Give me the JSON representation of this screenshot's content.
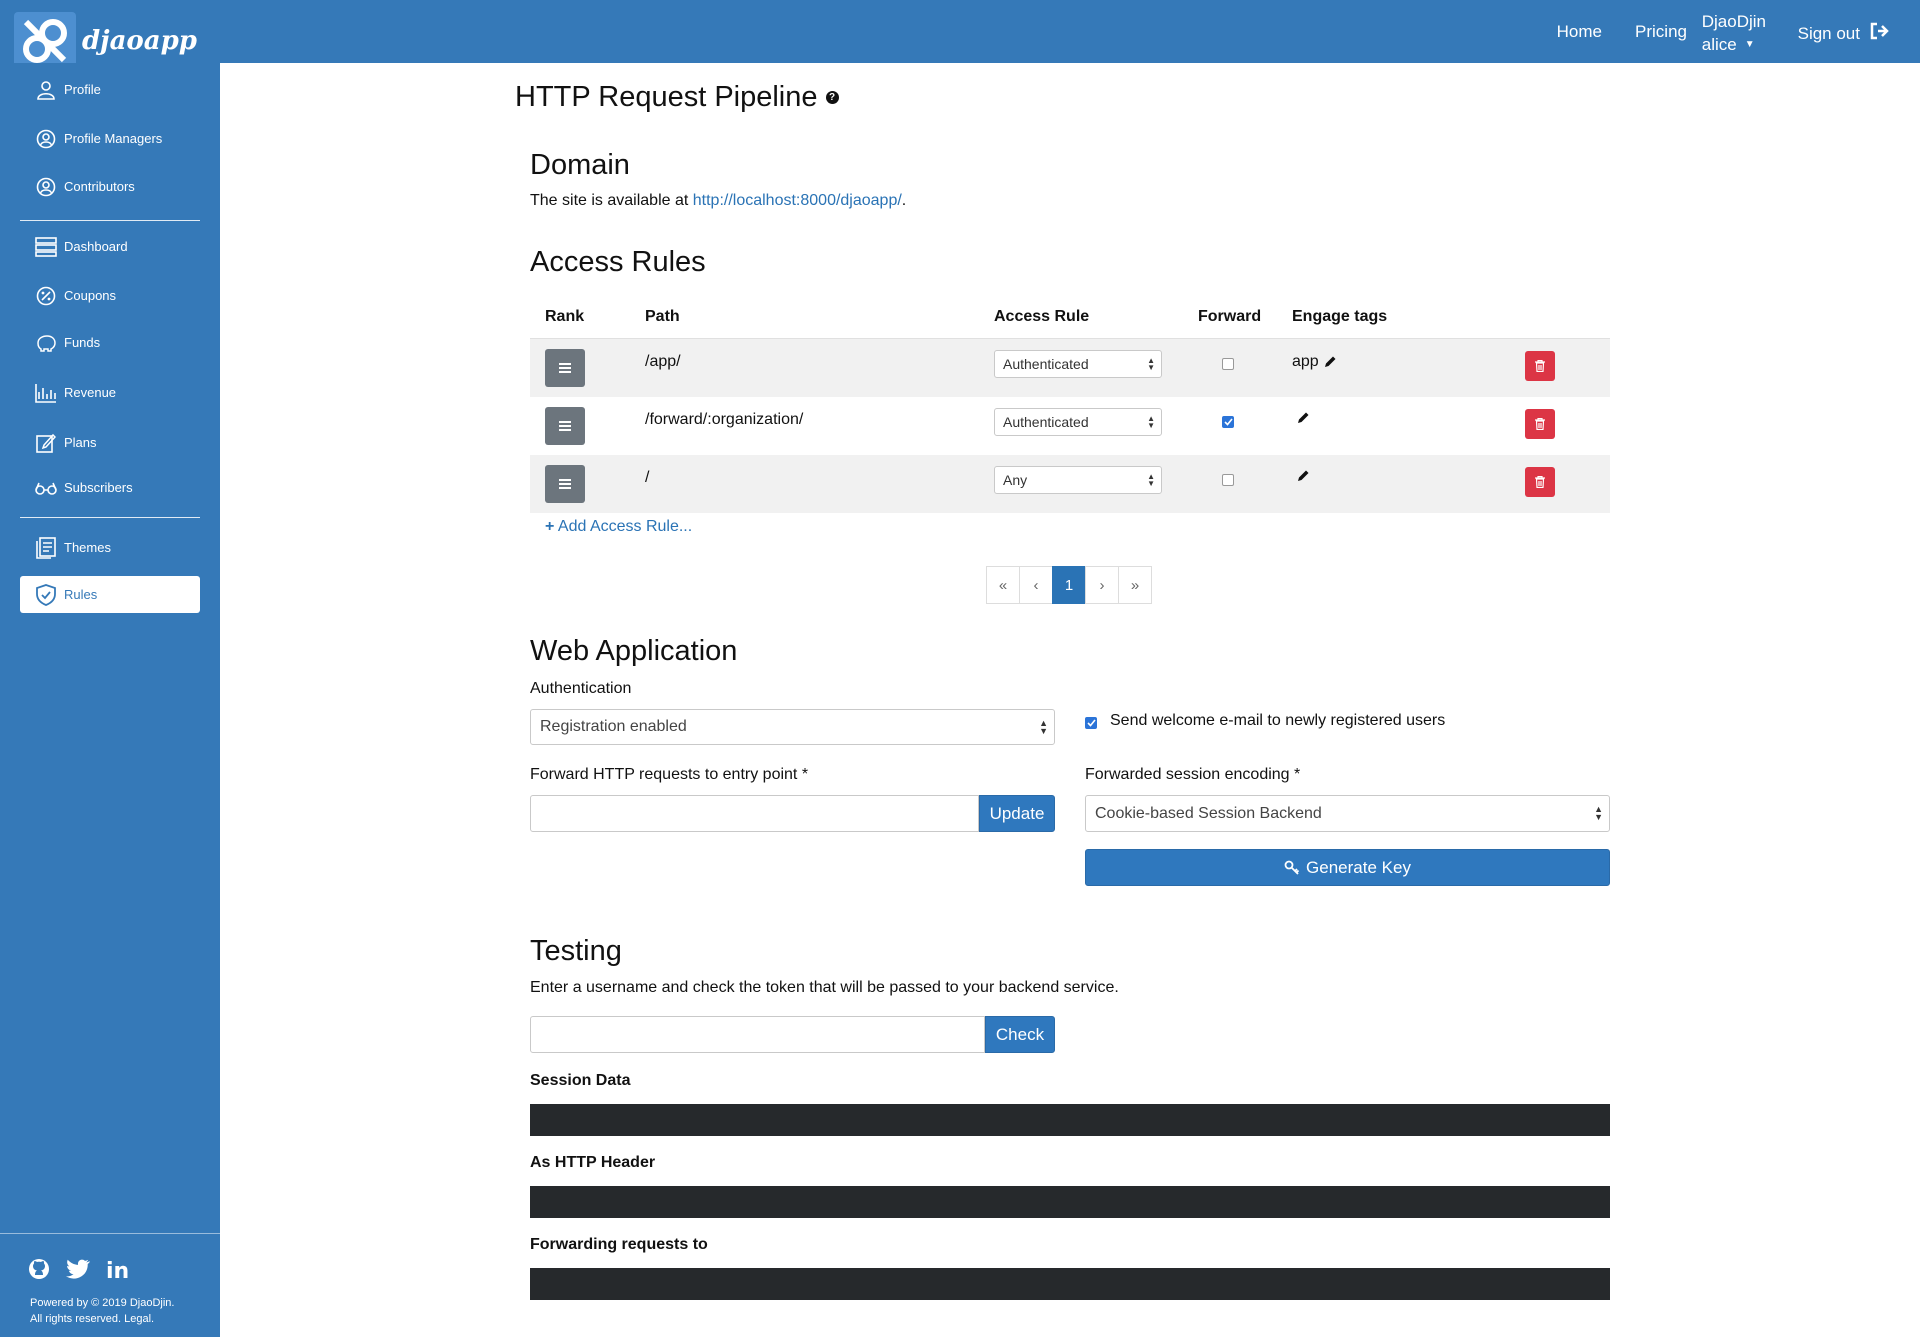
{
  "header": {
    "brand": "djaoapp",
    "nav": {
      "home": "Home",
      "pricing": "Pricing",
      "org_name": "DjaoDjin",
      "user_name": "alice",
      "signout": "Sign out"
    }
  },
  "sidebar": {
    "items": [
      {
        "label": "Profile",
        "icon": "user-icon"
      },
      {
        "label": "Profile Managers",
        "icon": "user-circle-icon"
      },
      {
        "label": "Contributors",
        "icon": "user-circle-icon"
      },
      {
        "label": "Dashboard",
        "icon": "dashboard-icon"
      },
      {
        "label": "Coupons",
        "icon": "percent-icon"
      },
      {
        "label": "Funds",
        "icon": "piggy-bank-icon"
      },
      {
        "label": "Revenue",
        "icon": "chart-icon"
      },
      {
        "label": "Plans",
        "icon": "edit-icon"
      },
      {
        "label": "Subscribers",
        "icon": "glasses-icon"
      },
      {
        "label": "Themes",
        "icon": "document-icon"
      },
      {
        "label": "Rules",
        "icon": "shield-icon"
      }
    ],
    "active": "Rules",
    "footer": {
      "line1": "Powered by © 2019 DjaoDjin.",
      "line2": "All rights reserved. Legal."
    }
  },
  "page": {
    "title": "HTTP Request Pipeline",
    "domain": {
      "heading": "Domain",
      "text_before": "The site is available at ",
      "link": "http://localhost:8000/djaoapp/",
      "text_after": "."
    },
    "access_rules": {
      "heading": "Access Rules",
      "columns": [
        "Rank",
        "Path",
        "Access Rule",
        "Forward",
        "Engage tags"
      ],
      "rows": [
        {
          "path": "/app/",
          "rule": "Authenticated",
          "forward": false,
          "tags": "app"
        },
        {
          "path": "/forward/:organization/",
          "rule": "Authenticated",
          "forward": true,
          "tags": ""
        },
        {
          "path": "/",
          "rule": "Any",
          "forward": false,
          "tags": ""
        }
      ],
      "add_label": "Add Access Rule...",
      "pagination": [
        "«",
        "‹",
        "1",
        "›",
        "»"
      ],
      "current_page": "1"
    },
    "web_app": {
      "heading": "Web Application",
      "auth_label": "Authentication",
      "auth_value": "Registration enabled",
      "welcome_label": "Send welcome e-mail to newly registered users",
      "welcome_checked": true,
      "entry_label": "Forward HTTP requests to entry point *",
      "entry_value": "",
      "update_label": "Update",
      "encoding_label": "Forwarded session encoding *",
      "encoding_value": "Cookie-based Session Backend",
      "generate_label": "Generate Key"
    },
    "testing": {
      "heading": "Testing",
      "description": "Enter a username and check the token that will be passed to your backend service.",
      "username_value": "",
      "check_label": "Check",
      "session_data_label": "Session Data",
      "http_header_label": "As HTTP Header",
      "forwarding_label": "Forwarding requests to"
    }
  },
  "colors": {
    "brand": "#3579b8",
    "danger": "#dc3545",
    "dark": "#26292c"
  }
}
